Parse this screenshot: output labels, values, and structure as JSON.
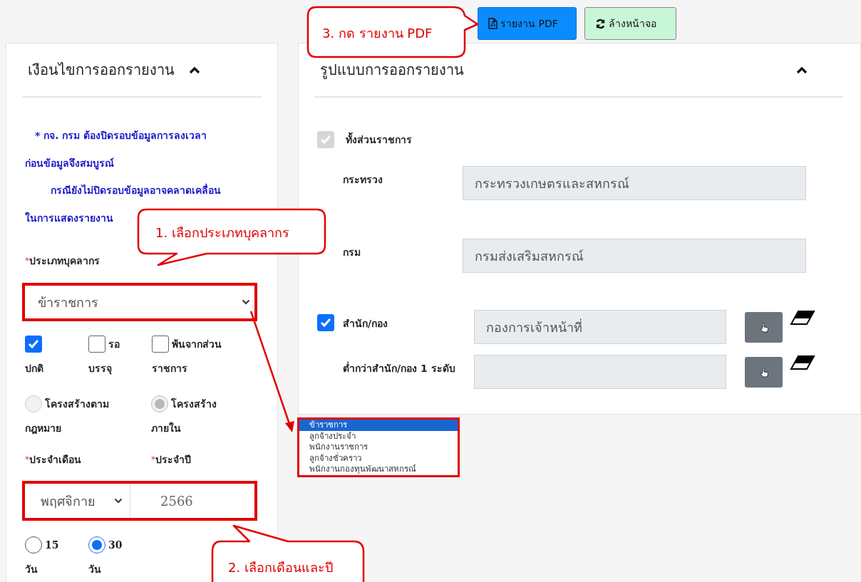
{
  "toolbar": {
    "buttons": [
      {
        "label": "รายงาน PDF",
        "kind": "pdf"
      },
      {
        "label": "ล้างหน้าจอ",
        "kind": "clear"
      }
    ]
  },
  "conditions_panel": {
    "title": "เงือนไขการออกรายงาน",
    "expanded": true,
    "notes": [
      "* กจ. กรม ต้องปิดรอบข้อมูลการลงเวลา ก่อนข้อมูลจึงสมบูรณ์",
      "กรณียังไม่ปิดรอบข้อมูลอาจคลาดเคลื่อน ในการแสดงรายงาน"
    ],
    "personnel_type": {
      "required_mark": "*",
      "label": "ประเภทบุคลากร",
      "value": "ข้าราชการ"
    },
    "status_checks": [
      {
        "label": "ปกติ",
        "checked": true
      },
      {
        "label": [
          "รอ",
          "บรรจุ"
        ],
        "checked": false
      },
      {
        "label": [
          "พ้นจากส่วน",
          "ราชการ"
        ],
        "checked": false
      }
    ],
    "structure": [
      {
        "label": [
          "โครงสร้างตาม",
          "กฎหมาย"
        ],
        "selected": false,
        "disabled": true
      },
      {
        "label": [
          "โครงสร้าง",
          "ภายใน"
        ],
        "selected": true,
        "disabled": true
      }
    ],
    "month": {
      "required_mark": "*",
      "label": "ประจำเดือน",
      "value": "พฤศจิกาย"
    },
    "year": {
      "required_mark": "*",
      "label": "ประจำปี",
      "value": "2566"
    },
    "period": [
      {
        "label": [
          "15",
          "วัน"
        ],
        "selected": false
      },
      {
        "label": [
          "30",
          "วัน"
        ],
        "selected": true
      }
    ]
  },
  "format_panel": {
    "title": "รูปแบบการออกรายงาน",
    "expanded": true,
    "whole_agency": {
      "label": "ทั้งส่วนราชการ",
      "checked": true,
      "disabled": true
    },
    "rows": [
      {
        "kind": "plain",
        "label": "กระทรวง",
        "value": "กระทรวงเกษตรและสหกรณ์"
      },
      {
        "kind": "plain",
        "label": "กรม",
        "value": "กรมส่งเสริมสหกรณ์"
      },
      {
        "kind": "picker",
        "label": "สำนัก/กอง",
        "checked": true,
        "value": "กองการเจ้าหน้าที่"
      },
      {
        "kind": "picker",
        "label": "ต่ำกว่าสำนัก/กอง 1 ระดับ"
      }
    ]
  },
  "personnel_options": [
    {
      "label": "ข้าราชการ",
      "selected": true
    },
    {
      "label": "ลูกจ้างประจำ",
      "selected": false
    },
    {
      "label": "พนักงานราชการ",
      "selected": false
    },
    {
      "label": "ลูกจ้างชั่วคราว",
      "selected": false
    },
    {
      "label": "พนักงานกองทุนพัฒนาสหกรณ์",
      "selected": false
    }
  ],
  "callouts": [
    "1. เลือกประเภทบุคลากร",
    "2. เลือกเดือนและปี",
    "3. กด รายงาน PDF"
  ]
}
